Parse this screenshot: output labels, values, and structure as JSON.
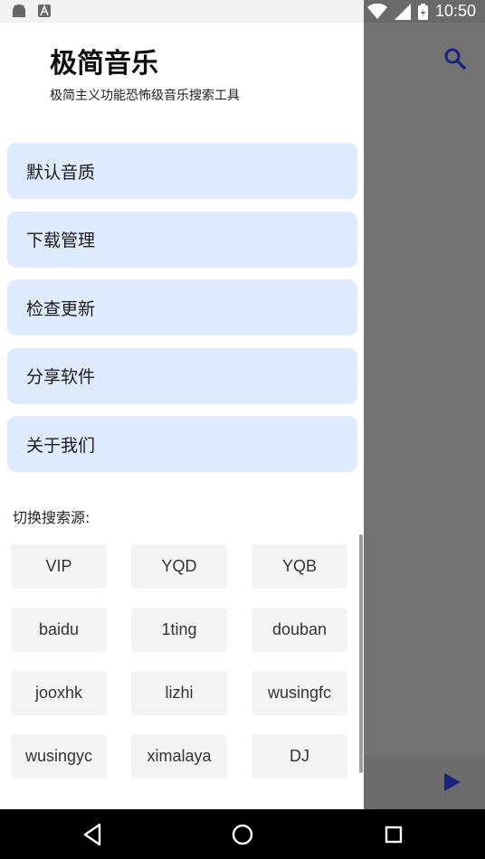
{
  "status_bar": {
    "time": "10:50",
    "icons": [
      "android-icon",
      "a-letter-icon",
      "wifi-icon",
      "signal-icon",
      "battery-icon"
    ]
  },
  "drawer": {
    "title": "极简音乐",
    "subtitle": "极简主义功能恐怖级音乐搜索工具",
    "menu": [
      {
        "label": "默认音质"
      },
      {
        "label": "下载管理"
      },
      {
        "label": "检查更新"
      },
      {
        "label": "分享软件"
      },
      {
        "label": "关于我们"
      }
    ],
    "sources_label": "切换搜索源:",
    "sources": [
      "VIP",
      "YQD",
      "YQB",
      "baidu",
      "1ting",
      "douban",
      "jooxhk",
      "lizhi",
      "wusingfc",
      "wusingyc",
      "ximalaya",
      "DJ"
    ]
  },
  "colors": {
    "menu_bg": "#deeafd",
    "chip_bg": "#f4f4f4",
    "scrim": "#737373",
    "icon_accent": "#1a237e"
  },
  "nav": {
    "icons": [
      "back-icon",
      "home-icon",
      "recents-icon"
    ]
  }
}
